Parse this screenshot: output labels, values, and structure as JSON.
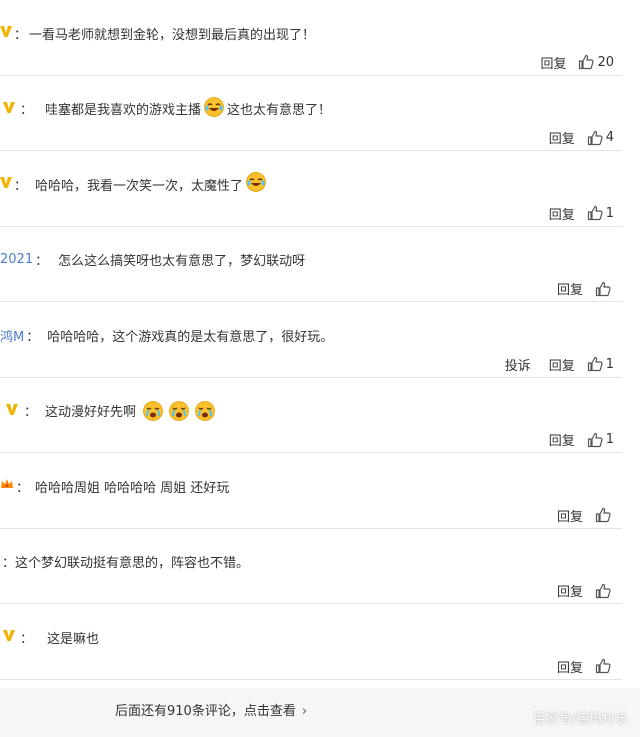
{
  "colors": {
    "vip_badge": "#f2b400",
    "name_link": "#4a7cc7",
    "divider": "#e4e4e4",
    "emoji_face": "#fbc02d",
    "crown": "#ff8c00"
  },
  "comments": [
    {
      "name": "",
      "badge": "vip",
      "text": "一看马老师就想到金轮，没想到最后真的出现了！",
      "emojis": [],
      "complaint": "",
      "reply": "回复",
      "likes": "20"
    },
    {
      "name": "",
      "badge": "vip",
      "text": "哇塞都是我喜欢的游戏主播",
      "emoji_after_text": "laughing-crying-emoji",
      "text2": "这也太有意思了！",
      "complaint": "",
      "reply": "回复",
      "likes": "4"
    },
    {
      "name": "",
      "badge": "vip",
      "text": "哈哈哈，我看一次笑一次，太魔性了",
      "emojis": [
        "laughing-crying-emoji"
      ],
      "complaint": "",
      "reply": "回复",
      "likes": "1"
    },
    {
      "name": "2021",
      "badge": "",
      "text": "怎么这么搞笑呀也太有意思了，梦幻联动呀",
      "emojis": [],
      "complaint": "",
      "reply": "回复",
      "likes": ""
    },
    {
      "name": "鸿M",
      "badge": "",
      "text": "哈哈哈哈，这个游戏真的是太有意思了，很好玩。",
      "emojis": [],
      "complaint": "投诉",
      "reply": "回复",
      "likes": "1"
    },
    {
      "name": "",
      "badge": "vip",
      "text": "这动漫好好先啊",
      "emojis": [
        "crying-emoji",
        "crying-emoji",
        "crying-emoji"
      ],
      "complaint": "",
      "reply": "回复",
      "likes": "1"
    },
    {
      "name": "",
      "badge": "crown",
      "text": "哈哈哈周姐 哈哈哈哈 周姐 还好玩",
      "emojis": [],
      "complaint": "",
      "reply": "回复",
      "likes": ""
    },
    {
      "name": "",
      "badge": "",
      "text": "这个梦幻联动挺有意思的，阵容也不错。",
      "emojis": [],
      "complaint": "",
      "reply": "回复",
      "likes": ""
    },
    {
      "name": "",
      "badge": "vip",
      "text": "这是嘛也",
      "emojis": [],
      "complaint": "",
      "reply": "回复",
      "likes": ""
    }
  ],
  "footer": {
    "more_text": "后面还有910条评论，点击查看",
    "more_arrow": "›",
    "watermark": "百家号/德玛村长"
  }
}
